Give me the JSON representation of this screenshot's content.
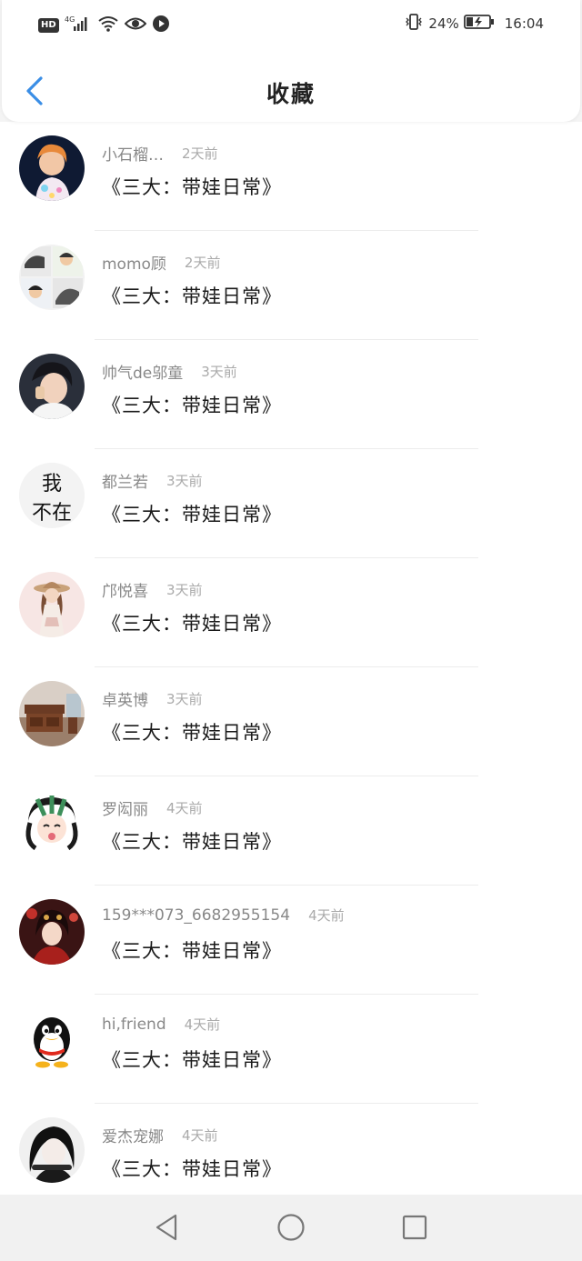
{
  "status_bar": {
    "hd": "HD",
    "network": "4G",
    "battery": "24%",
    "time": "16:04"
  },
  "nav": {
    "title": "收藏"
  },
  "items": [
    {
      "name": "小石榴…",
      "time": "2天前",
      "title": "《三大：带娃日常》",
      "avatar": "avatar-photo-pink"
    },
    {
      "name": "momo顾",
      "time": "2天前",
      "title": "《三大：带娃日常》",
      "avatar": "avatar-collage"
    },
    {
      "name": "帅气de邬童",
      "time": "3天前",
      "title": "《三大：带娃日常》",
      "avatar": "avatar-photo-boy"
    },
    {
      "name": "都兰若",
      "time": "3天前",
      "title": "《三大：带娃日常》",
      "avatar": "avatar-text",
      "avatar_text": [
        "我",
        "不在"
      ]
    },
    {
      "name": "邝悦喜",
      "time": "3天前",
      "title": "《三大：带娃日常》",
      "avatar": "avatar-illustration-girl"
    },
    {
      "name": "卓英博",
      "time": "3天前",
      "title": "《三大：带娃日常》",
      "avatar": "avatar-furniture"
    },
    {
      "name": "罗闳丽",
      "time": "4天前",
      "title": "《三大：带娃日常》",
      "avatar": "avatar-cartoon"
    },
    {
      "name": "159***073_6682955154",
      "time": "4天前",
      "title": "《三大：带娃日常》",
      "avatar": "avatar-photo-red"
    },
    {
      "name": "hi,friend",
      "time": "4天前",
      "title": "《三大：带娃日常》",
      "avatar": "avatar-penguin"
    },
    {
      "name": "爱杰宠娜",
      "time": "4天前",
      "title": "《三大：带娃日常》",
      "avatar": "avatar-photo-bw"
    }
  ],
  "colors": {
    "accent": "#3a8ee6",
    "title_text": "#1a1a1a",
    "meta_text": "#888888"
  }
}
